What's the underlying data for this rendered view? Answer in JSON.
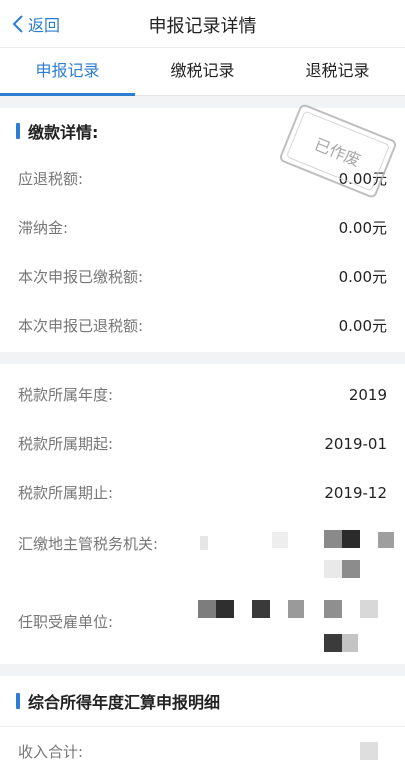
{
  "nav": {
    "back_label": "返回",
    "title": "申报记录详情"
  },
  "tabs": [
    {
      "label": "申报记录",
      "active": true
    },
    {
      "label": "缴税记录",
      "active": false
    },
    {
      "label": "退税记录",
      "active": false
    }
  ],
  "payment": {
    "title": "缴款详情:",
    "stamp_text": "已作废",
    "rows": [
      {
        "label": "应退税额:",
        "value": "0.00元"
      },
      {
        "label": "滞纳金:",
        "value": "0.00元"
      },
      {
        "label": "本次申报已缴税额:",
        "value": "0.00元"
      },
      {
        "label": "本次申报已退税额:",
        "value": "0.00元"
      }
    ]
  },
  "period": {
    "rows": [
      {
        "label": "税款所属年度:",
        "value": "2019"
      },
      {
        "label": "税款所属期起:",
        "value": "2019-01"
      },
      {
        "label": "税款所属期止:",
        "value": "2019-12"
      },
      {
        "label": "汇缴地主管税务机关:",
        "value": ""
      },
      {
        "label": "任职受雇单位:",
        "value": ""
      }
    ]
  },
  "annual": {
    "title": "综合所得年度汇算申报明细",
    "rows": [
      {
        "label": "收入合计:",
        "value": ""
      }
    ]
  },
  "colors": {
    "accent": "#2d7dd2",
    "background": "#f2f3f5"
  }
}
